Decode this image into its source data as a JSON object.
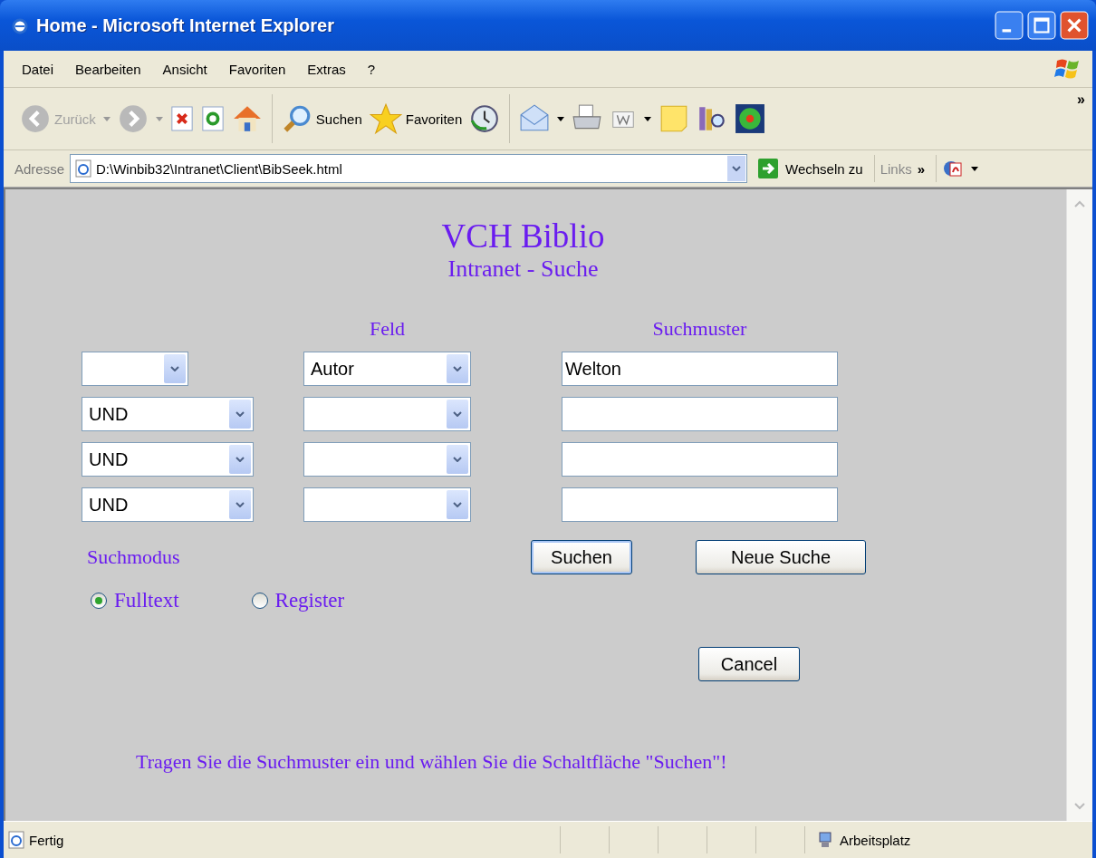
{
  "window": {
    "title": "Home - Microsoft Internet Explorer"
  },
  "menu": [
    "Datei",
    "Bearbeiten",
    "Ansicht",
    "Favoriten",
    "Extras",
    "?"
  ],
  "toolbar": {
    "back": {
      "label": "Zurück",
      "disabled": true
    },
    "search": "Suchen",
    "favorites": "Favoriten",
    "more": "»"
  },
  "address": {
    "label": "Adresse",
    "value": "D:\\Winbib32\\Intranet\\Client\\BibSeek.html",
    "go": "Wechseln zu",
    "links": "Links",
    "more": "»"
  },
  "page": {
    "title": "VCH Biblio",
    "subtitle": "Intranet - Suche",
    "headers": [
      "Feld",
      "Suchmuster"
    ],
    "rows": [
      {
        "field": "Autor",
        "pattern": "Welton"
      },
      {
        "operator": "UND"
      },
      {
        "operator": "UND"
      },
      {
        "operator": "UND"
      }
    ],
    "mode_label": "Suchmodus",
    "modes": [
      {
        "label": "Fulltext",
        "selected": true
      },
      {
        "label": "Register",
        "selected": false
      }
    ],
    "buttons": {
      "search": "Suchen",
      "new": "Neue Suche",
      "cancel": "Cancel"
    },
    "hint": "Tragen Sie die Suchmuster ein und wählen Sie die Schaltfläche \"Suchen\"!"
  },
  "status_bar": {
    "text": "Fertig",
    "zone": "Arbeitsplatz"
  }
}
